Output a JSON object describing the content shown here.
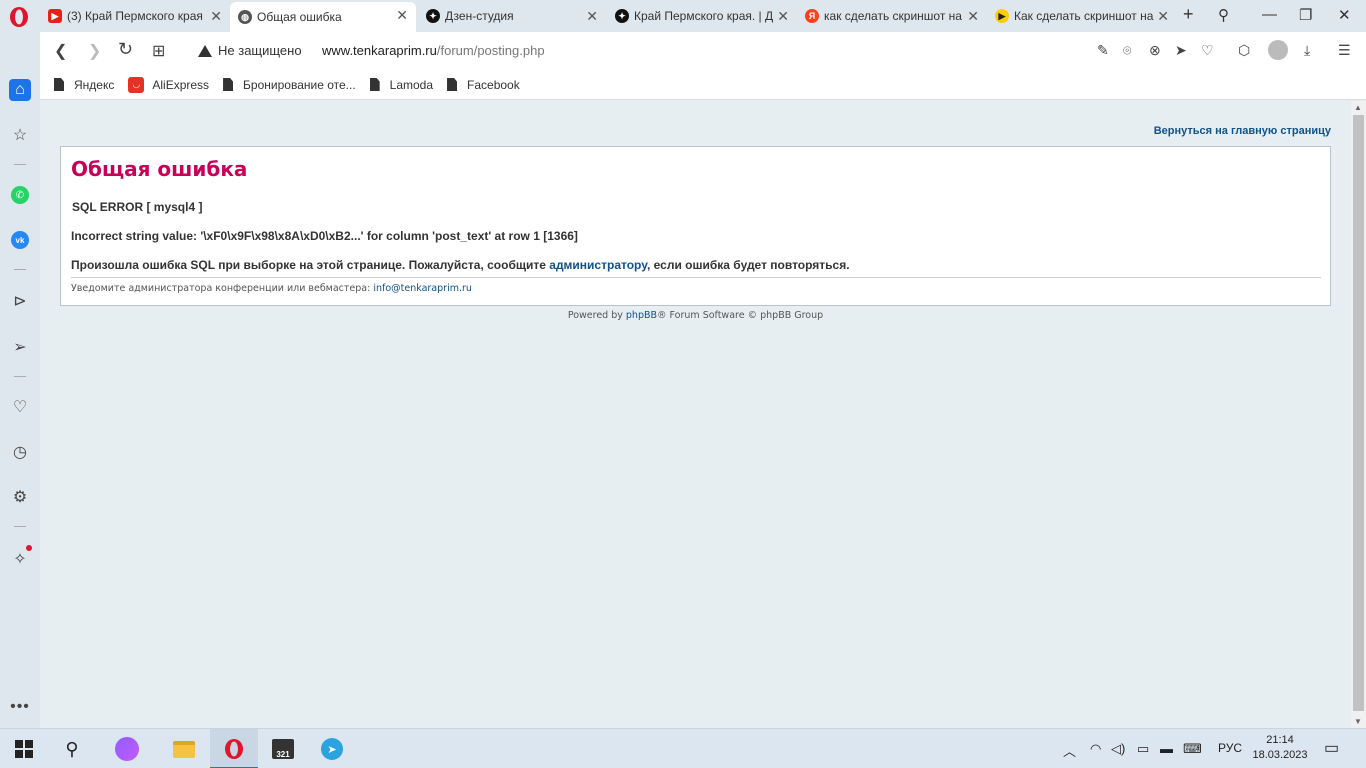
{
  "tabs": [
    {
      "title": "(3) Край Пермского края",
      "favicon": "youtube-icon",
      "active": false
    },
    {
      "title": "Общая ошибка",
      "favicon": "globe-icon",
      "active": true
    },
    {
      "title": "Дзен-студия",
      "favicon": "zen-icon",
      "active": false
    },
    {
      "title": "Край Пермского края. | Д",
      "favicon": "zen-icon",
      "active": false
    },
    {
      "title": "как сделать скриншот на",
      "favicon": "yandex-icon",
      "active": false
    },
    {
      "title": "Как сделать скриншот на",
      "favicon": "play-icon",
      "active": false
    }
  ],
  "addressbar": {
    "security": "Не защищено",
    "url_host": "www.tenkaraprim.ru",
    "url_path": "/forum/posting.php"
  },
  "bookmarks": [
    "Яндекс",
    "AliExpress",
    "Бронирование оте...",
    "Lamoda",
    "Facebook"
  ],
  "page": {
    "back_link": "Вернуться на главную страницу",
    "title": "Общая ошибка",
    "sql_error": "SQL ERROR [ mysql4 ]",
    "error_detail": "Incorrect string value: '\\xF0\\x9F\\x98\\x8A\\xD0\\xB2...' for column 'post_text' at row 1 [1366]",
    "message_before": "Произошла ошибка SQL при выборке на этой странице. Пожалуйста, сообщите ",
    "message_link": "администратору",
    "message_after": ", если ошибка будет повторяться.",
    "notify_text": "Уведомите администратора конференции или вебмастера: ",
    "notify_email": "info@tenkaraprim.ru",
    "powered_before": "Powered by ",
    "powered_link": "phpBB",
    "powered_after": "® Forum Software © phpBB Group"
  },
  "taskbar": {
    "language": "РУС",
    "time": "21:14",
    "date": "18.03.2023",
    "calendar_number": "321"
  },
  "colors": {
    "title": "#c90058",
    "link": "#105289",
    "opera": "#e0142b"
  }
}
